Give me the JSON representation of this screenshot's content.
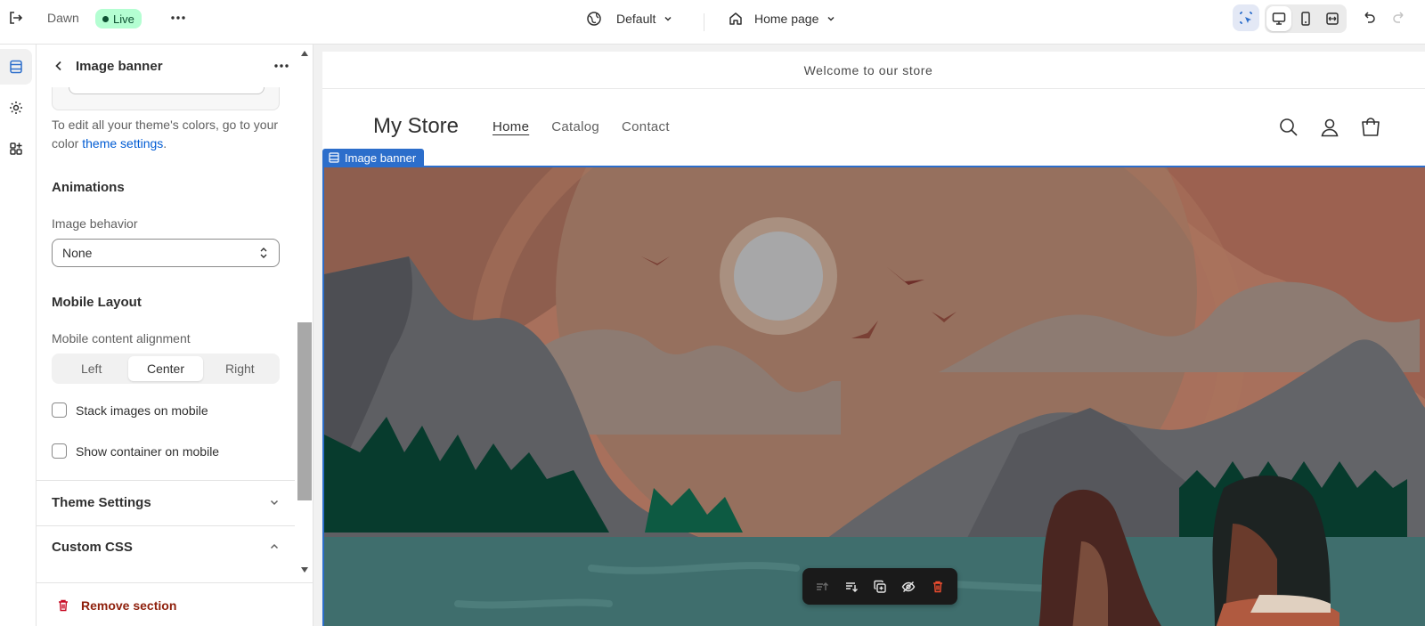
{
  "topbar": {
    "theme_name": "Dawn",
    "status_badge": "Live",
    "theme_picker": "Default",
    "page_picker": "Home page",
    "icons": [
      "exit-icon",
      "more-icon",
      "globe-icon",
      "chevron-down-icon",
      "home-icon",
      "select-tool-icon",
      "desktop-icon",
      "mobile-icon",
      "fullwidth-icon",
      "undo-icon",
      "redo-icon"
    ]
  },
  "rail": {
    "icons": [
      "sections-icon",
      "settings-gear-icon",
      "apps-icon"
    ]
  },
  "panel": {
    "title": "Image banner",
    "color_help_prefix": "To edit all your theme's colors, go to your color ",
    "color_help_link": "theme settings",
    "color_help_suffix": ".",
    "animations_title": "Animations",
    "image_behavior_label": "Image behavior",
    "image_behavior_value": "None",
    "mobile_layout_title": "Mobile Layout",
    "mobile_alignment_label": "Mobile content alignment",
    "alignment_options": [
      "Left",
      "Center",
      "Right"
    ],
    "alignment_selected": "Center",
    "stack_images_label": "Stack images on mobile",
    "show_container_label": "Show container on mobile",
    "theme_settings_title": "Theme Settings",
    "custom_css_title": "Custom CSS",
    "remove_section_label": "Remove section"
  },
  "preview": {
    "announcement": "Welcome to our store",
    "store_name": "My Store",
    "nav": [
      "Home",
      "Catalog",
      "Contact"
    ],
    "section_tag": "Image banner"
  },
  "colors": {
    "accent": "#2c6ecb",
    "live_badge_bg": "#b4fed2",
    "link": "#005bd3",
    "destructive": "#8e1f0b"
  }
}
